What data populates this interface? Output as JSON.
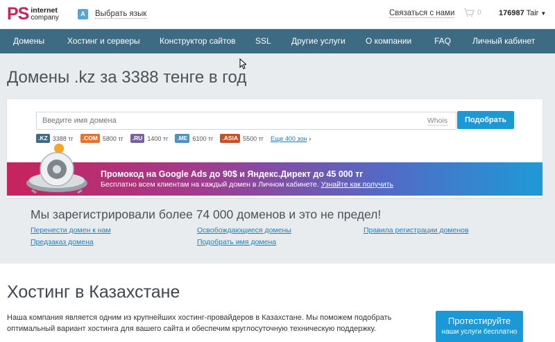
{
  "header": {
    "logo_ps": "PS",
    "logo_line1": "internet",
    "logo_line2": "company",
    "lang_label": "Выбрать язык",
    "contact_label": "Связаться с нами",
    "cart_count": "0",
    "account_id": "176987",
    "account_name": "Tair"
  },
  "nav": {
    "items": [
      {
        "label": "Домены"
      },
      {
        "label": "Хостинг и серверы"
      },
      {
        "label": "Конструктор сайтов"
      },
      {
        "label": "SSL"
      },
      {
        "label": "Другие услуги"
      },
      {
        "label": "О компании"
      },
      {
        "label": "FAQ"
      },
      {
        "label": "Личный кабинет"
      }
    ]
  },
  "hero": {
    "title": "Домены .kz за 3388 тенге в год",
    "search_placeholder": "Введите имя домена",
    "whois_label": "Whois",
    "search_button": "Подобрать",
    "zones": [
      {
        "tag": ".KZ",
        "price": "3388 тг",
        "color": "#3e6b84"
      },
      {
        "tag": ".COM",
        "price": "5800 тг",
        "color": "#e8702a"
      },
      {
        "tag": ".RU",
        "price": "1400 тг",
        "color": "#7a5fa0"
      },
      {
        "tag": ".ME",
        "price": "6100 тг",
        "color": "#4a90c0"
      },
      {
        "tag": ".ASIA",
        "price": "5500 тг",
        "color": "#c84f2a"
      }
    ],
    "more_zones": "Еще 400 зон"
  },
  "promo": {
    "title": "Промокод на Google Ads до 90$ и Яндекс.Директ до 45 000 тг",
    "subtitle": "Бесплатно всем клиентам на каждый домен в Личном кабинете.",
    "link": "Узнайте как получить"
  },
  "stats": {
    "title": "Мы зарегистрировали более 74 000 доменов и это не предел!",
    "col1": [
      "Перенести домен к нам",
      "Предзаказ домена"
    ],
    "col2": [
      "Освобождающиеся домены",
      "Подобрать имя домена"
    ],
    "col3": [
      "Правила регистрации доменов"
    ]
  },
  "hosting": {
    "title": "Хостинг в Казахстане",
    "description": "Наша компания является одним из крупнейших хостинг-провайдеров в Казахстане. Мы поможем подобрать оптимальный вариант хостинга для вашего сайта и обеспечим круглосуточную техническую поддержку.",
    "button_line1": "Протестируйте",
    "button_line2": "наши услуги бесплатно"
  },
  "colors": {
    "brand": "#c8235c",
    "nav_bg": "#3e6b84",
    "accent": "#1b99d6"
  }
}
